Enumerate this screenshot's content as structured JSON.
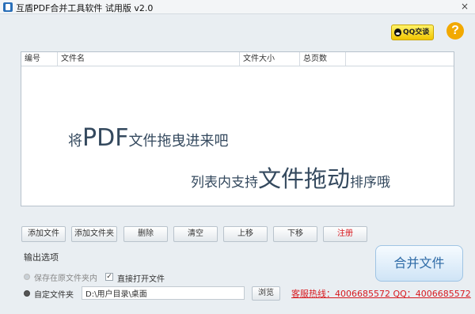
{
  "window": {
    "title": "互盾PDF合并工具软件 试用版 v2.0",
    "close_label": "×"
  },
  "header": {
    "qq_label": "QQ交谈",
    "help_label": "?"
  },
  "table": {
    "columns": [
      "编号",
      "文件名",
      "文件大小",
      "总页数"
    ]
  },
  "hint": {
    "line1_pre": "将",
    "line1_big": "PDF",
    "line1_post": "文件拖曳进来吧",
    "line2_pre": "列表内支持",
    "line2_big": "文件拖动",
    "line2_post": "排序哦"
  },
  "toolbar": {
    "add_file": "添加文件",
    "add_folder": "添加文件夹",
    "delete": "删除",
    "clear": "清空",
    "move_up": "上移",
    "move_down": "下移",
    "register": "注册"
  },
  "output": {
    "section_title": "输出选项",
    "save_original": "保存在原文件夹内",
    "open_file": "直接打开文件",
    "open_file_checked": true,
    "custom_folder": "自定文件夹",
    "path_value": "D:\\用户目录\\桌面",
    "browse": "浏览",
    "selected_option": "custom_folder"
  },
  "merge_label": "合并文件",
  "hotline": "客服热线：4006685572 QQ：4006685572",
  "colors": {
    "accent_red": "#d7191e",
    "merge_text": "#2d6aa6",
    "qq_yellow": "#f2c500"
  }
}
